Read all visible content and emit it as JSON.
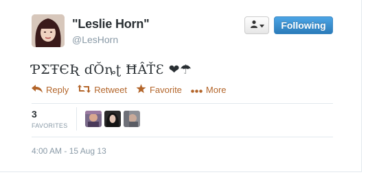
{
  "user": {
    "fullname": "\"Leslie Horn\"",
    "screen_name": "@LesHorn"
  },
  "follow_button": {
    "label": "Following"
  },
  "tweet": {
    "text": "ƤΣŦЄƦ ɗŎȵʈ ĦÂŤƐ ❤☂"
  },
  "actions": [
    {
      "label": "Reply",
      "icon": "reply-icon"
    },
    {
      "label": "Retweet",
      "icon": "retweet-icon"
    },
    {
      "label": "Favorite",
      "icon": "star-icon"
    },
    {
      "label": "More",
      "icon": "more-dots-icon"
    }
  ],
  "stats": {
    "favorites_count": "3",
    "favorites_label": "FAVORITES"
  },
  "timestamp": "4:00 AM - 15 Aug 13",
  "colors": {
    "action": "#b3652a",
    "follow": "#2b7bb9",
    "muted": "#8899a6"
  }
}
